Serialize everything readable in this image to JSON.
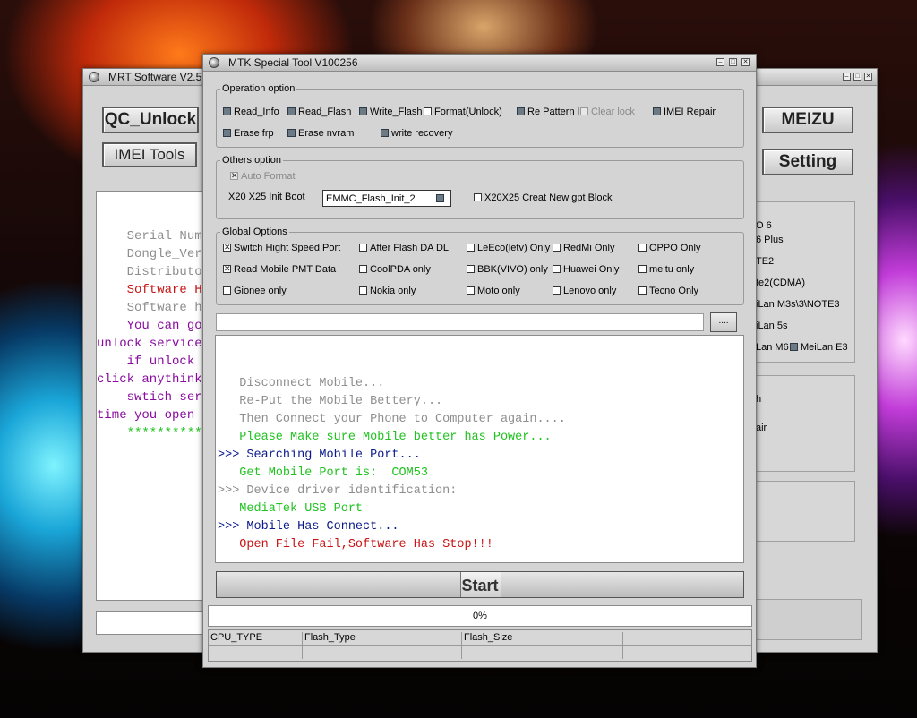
{
  "back_window": {
    "title": "MRT Software V2.56",
    "qc_unlock_label": "QC_Unlock",
    "imei_tools_label": "IMEI Tools",
    "meizu_label": "MEIZU",
    "setting_label": "Setting",
    "log_lines": [
      {
        "text": "    Serial Number",
        "color": "#8e8e8e"
      },
      {
        "text": "    Dongle_Version",
        "color": "#8e8e8e"
      },
      {
        "text": "    Distributor",
        "color": "#8e8e8e"
      },
      {
        "text": "    Software Has",
        "color": "#c81414"
      },
      {
        "text": "    Software has",
        "color": "#8e8e8e"
      },
      {
        "text": "    You can go",
        "color": "#8a0aa0"
      },
      {
        "text": "unlock service",
        "color": "#8a0aa0"
      },
      {
        "text": "    if unlock s",
        "color": "#8a0aa0"
      },
      {
        "text": "click anythink",
        "color": "#8a0aa0"
      },
      {
        "text": "    swtich serv",
        "color": "#8a0aa0"
      },
      {
        "text": "time you open t",
        "color": "#8a0aa0"
      },
      {
        "text": "    ***********",
        "color": "#1fc21f"
      }
    ],
    "model_list": [
      "O 6",
      "6 Plus",
      "TE2",
      "te2(CDMA)",
      "iLan M3s\\3\\NOTE3",
      "iLan 5s",
      "Lan M6"
    ],
    "meilan_e3": "MeiLan E3",
    "panel2_lines": [
      "h",
      "air"
    ]
  },
  "front_window": {
    "title": "MTK Special Tool V100256",
    "operation": {
      "legend": "Operation option",
      "read_info": "Read_Info",
      "read_flash": "Read_Flash",
      "write_flash": "Write_Flash",
      "format": "Format(Unlock)",
      "re_pattern": "Re Pattern l",
      "clear_lock": "Clear lock",
      "imei_repair": "IMEI Repair",
      "erase_frp": "Erase frp",
      "erase_nvram": "Erase nvram",
      "write_recovery": "write recovery"
    },
    "others": {
      "legend": "Others option",
      "auto_format": "Auto Format",
      "init_boot_label": "X20 X25 Init Boot",
      "init_boot_value": "EMMC_Flash_Init_2",
      "creat_gpt": "X20X25 Creat New gpt Block"
    },
    "global": {
      "legend": "Global Options",
      "switch_speed": "Switch Hight Speed Port",
      "after_flash": "After Flash DA DL",
      "leeco": "LeEco(letv) Only",
      "redmi": "RedMi Only",
      "oppo": "OPPO Only",
      "read_pmt": "Read Mobile PMT Data",
      "coolpda": "CoolPDA only",
      "bbk": "BBK(VIVO) only",
      "huawei": "Huawei Only",
      "meitu": "meitu only",
      "gionee": "Gionee only",
      "nokia": "Nokia only",
      "moto": "Moto only",
      "lenovo": "Lenovo only",
      "tecno": "Tecno Only"
    },
    "file_path": "",
    "browse_label": "....",
    "log": [
      {
        "text": "   Disconnect Mobile...",
        "color": "#8e8e8e"
      },
      {
        "text": "   Re-Put the Mobile Bettery...",
        "color": "#8e8e8e"
      },
      {
        "text": "   Then Connect your Phone to Computer again....",
        "color": "#8e8e8e"
      },
      {
        "text": "   Please Make sure Mobile better has Power...",
        "color": "#1fc21f"
      },
      {
        "text": ">>> Searching Mobile Port...",
        "color": "#0a1a8a"
      },
      {
        "text": "   Get Mobile Port is:  COM53",
        "color": "#1fc21f"
      },
      {
        "text": ">>> Device driver identification:",
        "color": "#8e8e8e"
      },
      {
        "text": "   MediaTek USB Port",
        "color": "#1fc21f"
      },
      {
        "text": ">>> Mobile Has Connect...",
        "color": "#0a1a8a"
      },
      {
        "text": "   Open File Fail,Software Has Stop!!!",
        "color": "#c81414"
      }
    ],
    "start_label": "Start",
    "progress_text": "0%",
    "progress_value": 0,
    "status_headers": [
      "CPU_TYPE",
      "Flash_Type",
      "Flash_Size",
      ""
    ]
  }
}
